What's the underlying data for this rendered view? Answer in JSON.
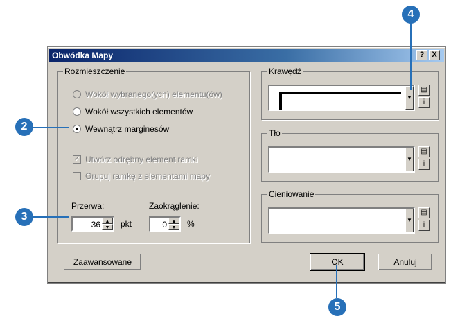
{
  "dialog": {
    "title": "Obwódka Mapy",
    "help_btn": "?",
    "close_btn": "X"
  },
  "placement": {
    "legend": "Rozmieszczenie",
    "options": [
      {
        "label": "Wokół wybranego(ych) elementu(ów)",
        "enabled": false,
        "selected": false
      },
      {
        "label": "Wokół wszystkich elementów",
        "enabled": true,
        "selected": false
      },
      {
        "label": "Wewnątrz marginesów",
        "enabled": true,
        "selected": true
      }
    ],
    "checkboxes": [
      {
        "label": "Utwórz odrębny element ramki",
        "checked": true,
        "enabled": false
      },
      {
        "label": "Grupuj ramkę z elementami mapy",
        "checked": false,
        "enabled": false
      }
    ],
    "gap_label": "Przerwa:",
    "gap_value": "36",
    "gap_unit": "pkt",
    "rounding_label": "Zaokrąglenie:",
    "rounding_value": "0",
    "rounding_unit": "%"
  },
  "border": {
    "legend": "Krawędź"
  },
  "background": {
    "legend": "Tło"
  },
  "shadow": {
    "legend": "Cieniowanie"
  },
  "buttons": {
    "advanced": "Zaawansowane",
    "ok": "OK",
    "cancel": "Anuluj"
  },
  "callouts": [
    "2",
    "3",
    "4",
    "5"
  ],
  "colors": {
    "callout": "#2770b8",
    "titlebar": "#0a246a",
    "dialog_bg": "#d4d0c8"
  }
}
